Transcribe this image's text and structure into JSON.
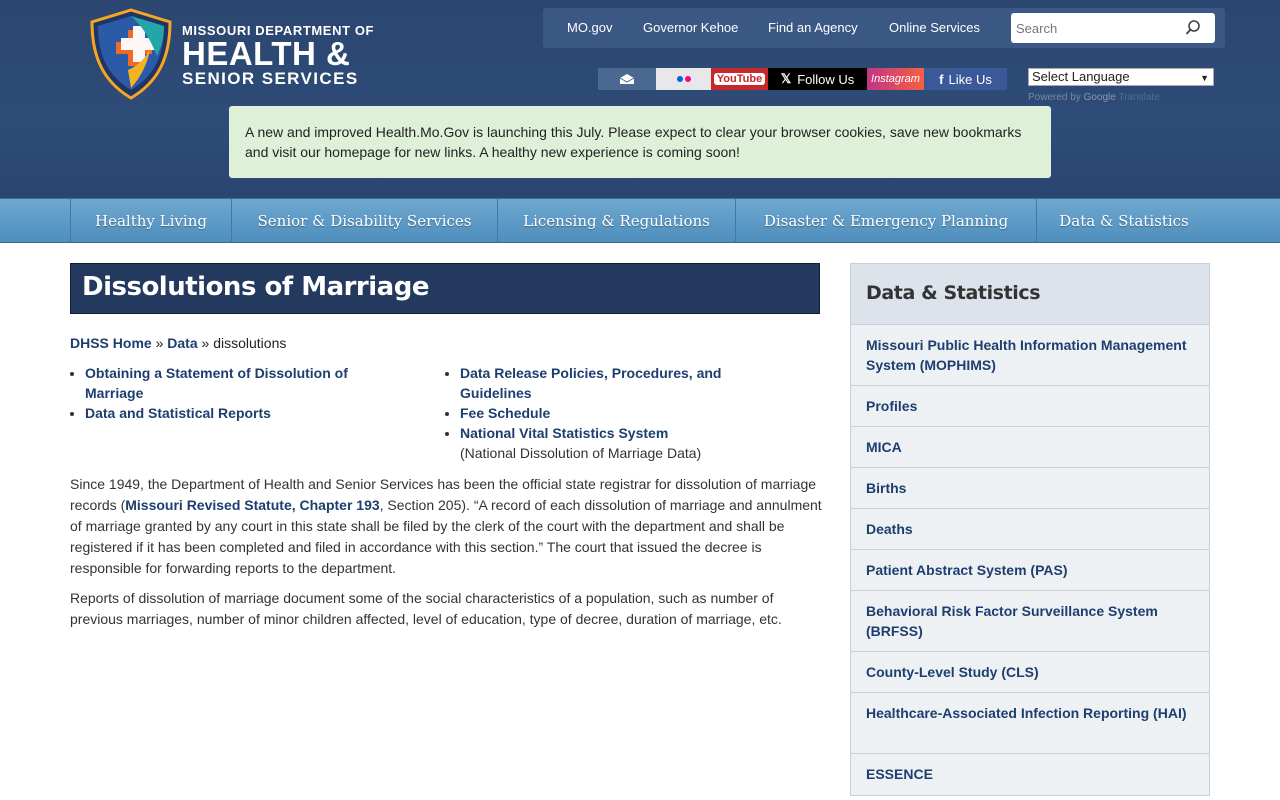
{
  "header": {
    "logo_line1": "MISSOURI DEPARTMENT OF",
    "logo_line2": "HEALTH &",
    "logo_line3": "SENIOR SERVICES",
    "top_links": [
      "MO.gov",
      "Governor Kehoe",
      "Find an Agency",
      "Online Services"
    ],
    "search_placeholder": "Search",
    "social": {
      "youtube": "YouTube",
      "follow_us": "Follow Us",
      "instagram": "Instagram",
      "like_us": "Like Us"
    },
    "language_select": "Select Language",
    "powered_by": "Powered by",
    "google": "Google",
    "translate": "Translate",
    "alert": "A new and improved Health.Mo.Gov is launching this July. Please expect to clear your browser cookies, save new bookmarks and visit our homepage for new links. A healthy new experience is coming soon!"
  },
  "main_nav": [
    "Healthy Living",
    "Senior & Disability Services",
    "Licensing & Regulations",
    "Disaster & Emergency Planning",
    "Data & Statistics"
  ],
  "content": {
    "title": "Dissolutions of Marriage",
    "breadcrumb": {
      "home": "DHSS Home",
      "sep1": "»",
      "data": "Data",
      "sep2": "»",
      "current": "dissolutions"
    },
    "links_left": [
      "Obtaining a Statement of Dissolution of Marriage",
      "Data and Statistical Reports"
    ],
    "links_right": [
      "Data Release Policies, Procedures, and Guidelines",
      "Fee Schedule",
      "National Vital Statistics System"
    ],
    "links_right_note": "(National Dissolution of Marriage Data)",
    "para1_a": "Since 1949, the Department of Health and Senior Services has been the official state registrar for dissolution of marriage records (",
    "para1_link": "Missouri Revised Statute, Chapter 193",
    "para1_b": ", Section 205). “A record of each dissolution of marriage and annulment of marriage granted by any court in this state shall be filed by the clerk of the court with the department and shall be registered if it has been completed and filed in accordance with this section.” The court that issued the decree is responsible for forwarding reports to the department.",
    "para2": "Reports of dissolution of marriage document some of the social characteristics of a population, such as number of previous marriages, number of minor children affected, level of education, type of decree, duration of marriage, etc."
  },
  "sidebar": {
    "title": "Data & Statistics",
    "items": [
      "Missouri Public Health Information Management System (MOPHIMS)",
      "Profiles",
      "MICA",
      "Births",
      "Deaths",
      "Patient Abstract System (PAS)",
      "Behavioral Risk Factor Surveillance System (BRFSS)",
      "County-Level Study (CLS)",
      "Healthcare-Associated Infection Reporting (HAI)",
      "ESSENCE"
    ]
  }
}
